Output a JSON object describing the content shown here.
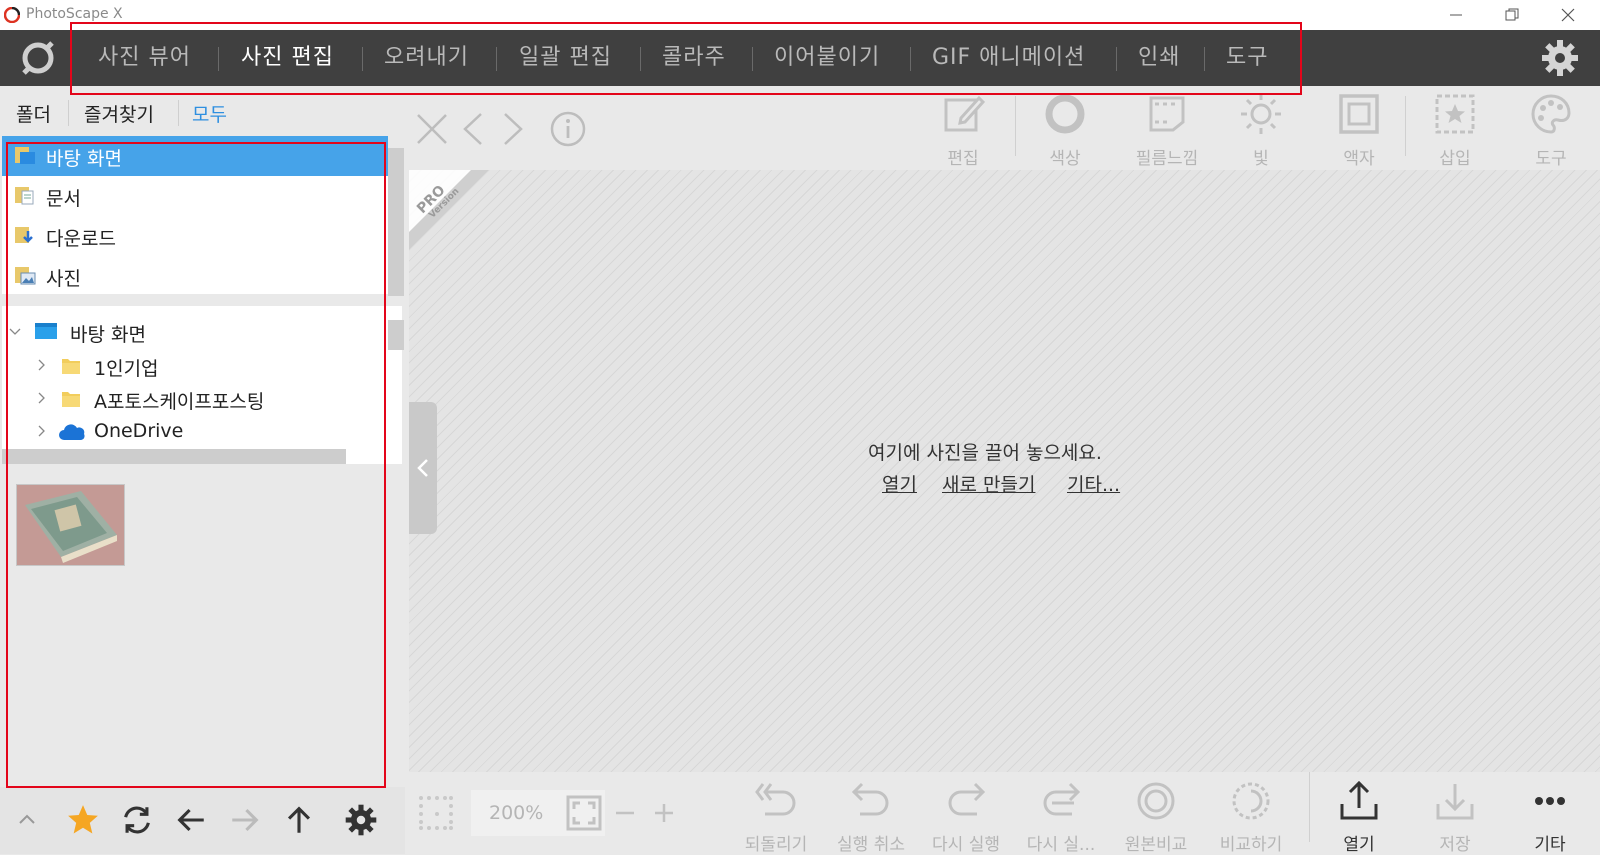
{
  "window": {
    "title": "PhotoScape X"
  },
  "menu": {
    "items": [
      "사진 뷰어",
      "사진 편집",
      "오려내기",
      "일괄 편집",
      "콜라주",
      "이어붙이기",
      "GIF 애니메이션",
      "인쇄",
      "도구"
    ],
    "active_index": 1
  },
  "sidebar": {
    "tabs": [
      "폴더",
      "즐겨찾기",
      "모두"
    ],
    "active_tab": "모두",
    "favorites": [
      "바탕 화면",
      "문서",
      "다운로드",
      "사진"
    ],
    "tree": {
      "root": "바탕 화면",
      "children": [
        "1인기업",
        "A포토스케이프포스팅",
        "OneDrive"
      ]
    }
  },
  "toolbar": {
    "items": [
      "편집",
      "색상",
      "필름느낌",
      "빛",
      "액자",
      "삽입",
      "도구"
    ]
  },
  "canvas": {
    "badge_pro": "PRO",
    "badge_version": "Version",
    "drop_message": "여기에 사진을 끌어 놓으세요.",
    "links": [
      "열기",
      "새로 만들기",
      "기타..."
    ]
  },
  "bottom": {
    "zoom": "200%",
    "actions": [
      "되돌리기",
      "실행 취소",
      "다시 실행",
      "다시 실...",
      "원본비교",
      "비교하기",
      "열기",
      "저장",
      "기타"
    ]
  },
  "colors": {
    "accent": "#46a3e9",
    "menu_bg": "#404040",
    "highlight_box": "#e3051a",
    "favorite_star": "#f5a623"
  }
}
